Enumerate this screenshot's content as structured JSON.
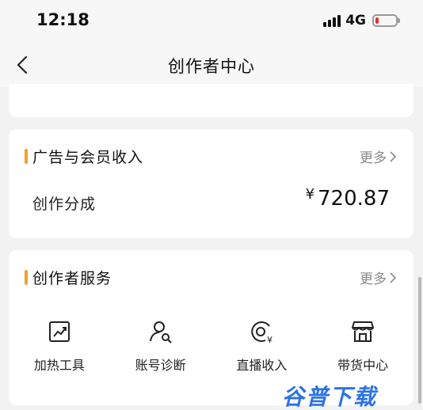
{
  "status": {
    "time": "12:18",
    "network": "4G"
  },
  "header": {
    "title": "创作者中心"
  },
  "top_card": {
    "cut_labels": [
      "",
      "",
      "",
      ""
    ]
  },
  "ad_card": {
    "title": "广告与会员收入",
    "more": "更多",
    "row_label": "创作分成",
    "currency": "¥",
    "amount": "720.87"
  },
  "service_card": {
    "title": "创作者服务",
    "more": "更多",
    "items": [
      {
        "label": "加热工具",
        "icon": "trend-chart-icon"
      },
      {
        "label": "账号诊断",
        "icon": "user-search-icon"
      },
      {
        "label": "直播收入",
        "icon": "live-income-icon"
      },
      {
        "label": "带货中心",
        "icon": "shop-icon"
      }
    ]
  },
  "watermark": "谷普下载",
  "colors": {
    "accent": "#f2a033",
    "watermark": "#2b73e6",
    "battery_low": "#e5322d"
  }
}
